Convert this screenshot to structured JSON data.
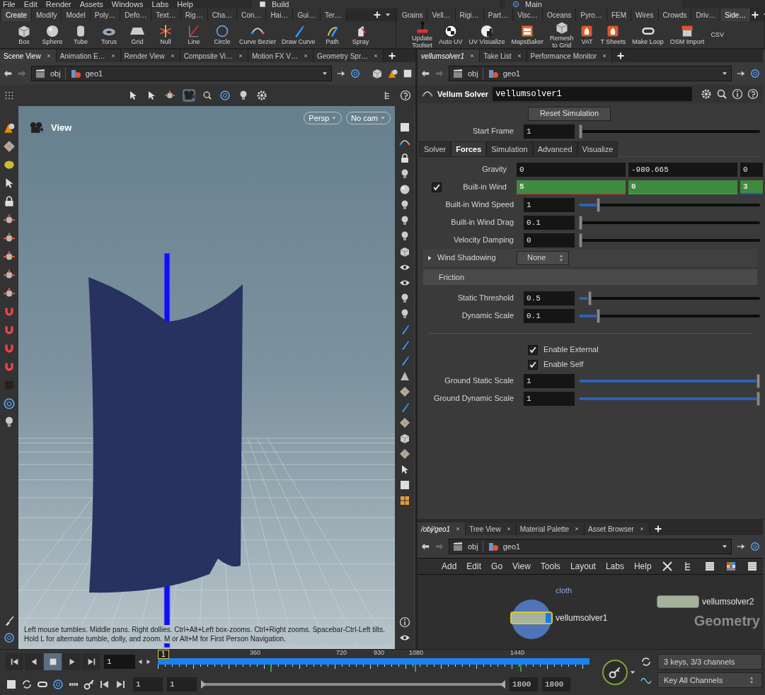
{
  "menu_bar": {
    "items": [
      "File",
      "Edit",
      "Render",
      "Assets",
      "Windows",
      "Labs",
      "Help"
    ],
    "desktop": "Build",
    "desktop_2": "Main"
  },
  "shelf_left": {
    "tabs": [
      {
        "label": "Create",
        "selected": true
      },
      {
        "label": "Modify",
        "selected": false
      },
      {
        "label": "Model",
        "selected": false
      },
      {
        "label": "Poly…",
        "selected": false
      },
      {
        "label": "Defo…",
        "selected": false
      },
      {
        "label": "Text…",
        "selected": false
      },
      {
        "label": "Rig…",
        "selected": false
      },
      {
        "label": "Cha…",
        "selected": false
      },
      {
        "label": "Con…",
        "selected": false
      },
      {
        "label": "Hai…",
        "selected": false
      },
      {
        "label": "Gui…",
        "selected": false
      },
      {
        "label": "Ter…",
        "selected": false
      }
    ],
    "tools": [
      "Box",
      "Sphere",
      "Tube",
      "Torus",
      "Grid",
      "Null",
      "Line",
      "Circle",
      "Curve Bezier",
      "Draw Curve",
      "Path",
      "Spray"
    ]
  },
  "shelf_right": {
    "tabs": [
      {
        "label": "Grains",
        "selected": false
      },
      {
        "label": "Vell…",
        "selected": false
      },
      {
        "label": "Rigi…",
        "selected": false
      },
      {
        "label": "Part…",
        "selected": false
      },
      {
        "label": "Visc…",
        "selected": false
      },
      {
        "label": "Oceans",
        "selected": false
      },
      {
        "label": "Pyro…",
        "selected": false
      },
      {
        "label": "FEM",
        "selected": false
      },
      {
        "label": "Wires",
        "selected": false
      },
      {
        "label": "Crowds",
        "selected": false
      },
      {
        "label": "Driv…",
        "selected": false
      },
      {
        "label": "Side…",
        "selected": true
      }
    ],
    "tools": [
      "Update\nToolset",
      "Auto UV",
      "UV Visualize",
      "MapsBaker",
      "Remesh\nto Grid",
      "VAT",
      "T Sheets",
      "Make Loop",
      "OSM Import",
      "CSV"
    ]
  },
  "scene_tabs": [
    {
      "label": "Scene View",
      "selected": true
    },
    {
      "label": "Animation E…",
      "selected": false
    },
    {
      "label": "Render View",
      "selected": false
    },
    {
      "label": "Composite Vi…",
      "selected": false
    },
    {
      "label": "Motion FX V…",
      "selected": false
    },
    {
      "label": "Geometry Spr…",
      "selected": false
    }
  ],
  "scene_path": [
    "obj",
    "geo1"
  ],
  "viewport": {
    "title": "View",
    "view_menu": "Persp",
    "camera_menu": "No cam",
    "help_text": "Left mouse tumbles. Middle pans. Right dollies. Ctrl+Alt+Left box-zooms. Ctrl+Right zooms. Spacebar-Ctrl-Left tilts. Hold L for alternate tumble, dolly, and zoom. M or Alt+M for First Person Navigation."
  },
  "param_tabs": [
    {
      "label": "vellumsolver1",
      "selected": true
    },
    {
      "label": "Take List",
      "selected": false
    },
    {
      "label": "Performance Monitor",
      "selected": false
    }
  ],
  "param_path": [
    "obj",
    "geo1"
  ],
  "node": {
    "type": "Vellum Solver",
    "name": "vellumsolver1"
  },
  "reset_button": "Reset Simulation",
  "start_frame": {
    "label": "Start Frame",
    "value": "1",
    "level": 0
  },
  "folder_tabs": [
    {
      "label": "Solver",
      "selected": false
    },
    {
      "label": "Forces",
      "selected": true
    },
    {
      "label": "Simulation",
      "selected": false
    },
    {
      "label": "Advanced",
      "selected": false
    },
    {
      "label": "Visualize",
      "selected": false
    }
  ],
  "params": [
    {
      "kind": "vector",
      "label": "Gravity",
      "keyed": false,
      "values": [
        "0",
        "-980.665",
        "0"
      ]
    },
    {
      "kind": "vector",
      "label": "Built-in Wind",
      "checked": true,
      "keyed": true,
      "values": [
        "5",
        "0",
        "3"
      ]
    },
    {
      "kind": "slider",
      "label": "Built-in Wind Speed",
      "value": "1",
      "level": 0.1
    },
    {
      "kind": "slider",
      "label": "Built-in Wind Drag",
      "value": "0.1",
      "level": 0
    },
    {
      "kind": "slider",
      "label": "Velocity Damping",
      "value": "0",
      "level": 0
    },
    {
      "kind": "menu",
      "label": "Wind Shadowing",
      "value": "None",
      "expanded": false
    },
    {
      "kind": "heading",
      "label": "Friction"
    },
    {
      "kind": "slider",
      "label": "Static Threshold",
      "value": "0.5",
      "level": 0.05
    },
    {
      "kind": "slider",
      "label": "Dynamic Scale",
      "value": "0.1",
      "level": 0.1
    },
    {
      "kind": "divider"
    },
    {
      "kind": "toggle",
      "label": "Enable External",
      "checked": true
    },
    {
      "kind": "toggle",
      "label": "Enable Self",
      "checked": true
    },
    {
      "kind": "slider",
      "label": "Ground Static Scale",
      "value": "1",
      "level": 1
    },
    {
      "kind": "slider",
      "label": "Ground Dynamic Scale",
      "value": "1",
      "level": 1
    }
  ],
  "network_tabs": [
    {
      "label": "/obj/geo1",
      "selected": true
    },
    {
      "label": "Tree View",
      "selected": false
    },
    {
      "label": "Material Palette",
      "selected": false
    },
    {
      "label": "Asset Browser",
      "selected": false
    }
  ],
  "network_path": [
    "obj",
    "geo1"
  ],
  "network_menu": [
    "Add",
    "Edit",
    "Go",
    "View",
    "Tools",
    "Layout",
    "Labs",
    "Help"
  ],
  "network": {
    "context_label": "Geometry",
    "group_label": "cloth",
    "nodes": [
      {
        "name": "vellumsolver1",
        "selected": true,
        "display": true
      },
      {
        "name": "vellumsolver2",
        "selected": false,
        "display": false
      }
    ]
  },
  "timeline": {
    "range_bar": {
      "level": 1
    },
    "frame": "1",
    "current_frame": "1",
    "ruler_labels": [
      "360",
      "720",
      "930",
      "1080",
      "1440"
    ],
    "range_start": "1",
    "range_start_2": "1",
    "range_end": "1800",
    "range_end_2": "1800",
    "keys_info": "3 keys, 3/3 channels",
    "key_menu": "Key All Channels"
  }
}
